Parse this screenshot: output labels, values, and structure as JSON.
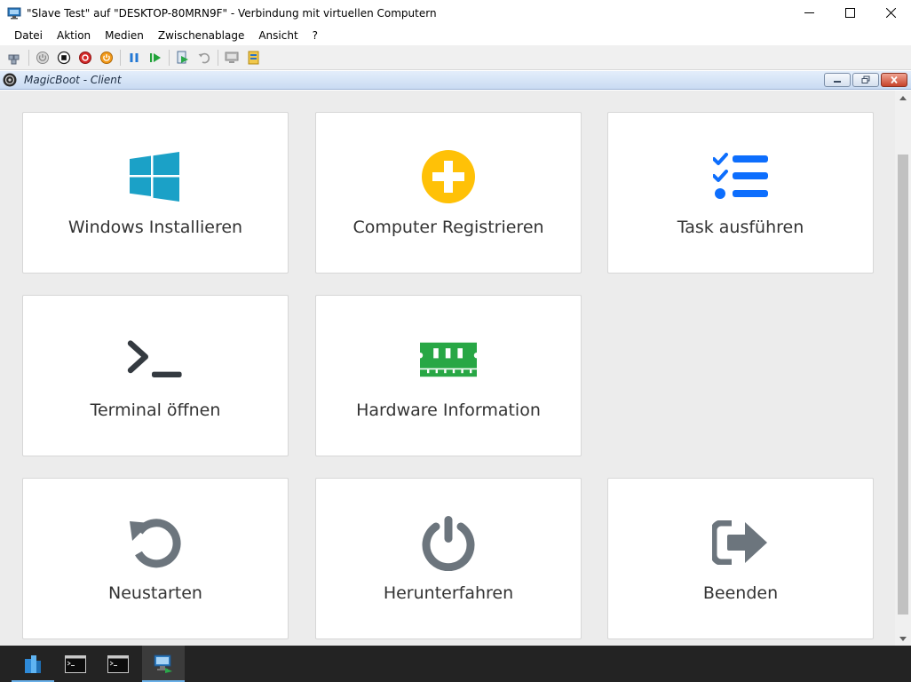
{
  "window": {
    "title": "\"Slave Test\" auf \"DESKTOP-80MRN9F\" - Verbindung mit virtuellen Computern"
  },
  "menu": {
    "items": [
      "Datei",
      "Aktion",
      "Medien",
      "Zwischenablage",
      "Ansicht",
      "?"
    ]
  },
  "toolbar": {
    "icons": [
      "ctrl-alt-del-icon",
      "start-icon",
      "turn-off-icon",
      "shutdown-icon",
      "power-icon",
      "pause-icon",
      "resume-icon",
      "checkpoint-icon",
      "revert-icon",
      "enhanced-session-icon",
      "share-icon"
    ]
  },
  "guest": {
    "title": "MagicBoot - Client"
  },
  "tiles": [
    {
      "label": "Windows Installieren",
      "icon": "windows-logo-icon",
      "color": "#1ba1c7"
    },
    {
      "label": "Computer Registrieren",
      "icon": "plus-circle-icon",
      "color": "#ffc107"
    },
    {
      "label": "Task ausführen",
      "icon": "task-list-icon",
      "color": "#0d6efd"
    },
    {
      "label": "Terminal öffnen",
      "icon": "terminal-icon",
      "color": "#343a40"
    },
    {
      "label": "Hardware Information",
      "icon": "memory-chip-icon",
      "color": "#28a745"
    },
    {
      "label": "Neustarten",
      "icon": "restart-icon",
      "color": "#6c757d"
    },
    {
      "label": "Herunterfahren",
      "icon": "power-off-icon",
      "color": "#6c757d"
    },
    {
      "label": "Beenden",
      "icon": "sign-out-icon",
      "color": "#6c757d"
    }
  ],
  "taskbar": {
    "items": [
      "server-manager-icon",
      "cmd-icon",
      "cmd-icon",
      "vm-connection-icon"
    ],
    "accent": "#6ab0e8"
  }
}
